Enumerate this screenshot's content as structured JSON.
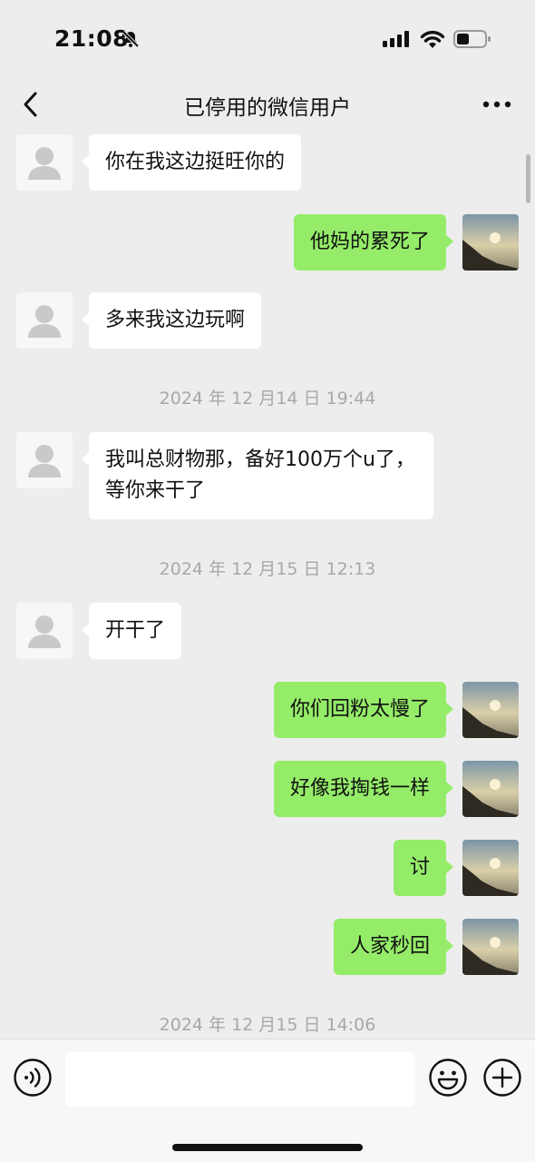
{
  "status_bar": {
    "time": "21:08",
    "icons": [
      "bell-off-icon",
      "signal-icon",
      "wifi-icon",
      "battery-icon"
    ]
  },
  "nav": {
    "title": "已停用的微信用户",
    "back_icon": "chevron-left-icon",
    "more_icon": "more-dots-icon"
  },
  "messages": [
    {
      "side": "left",
      "text": "你在我这边挺旺你的"
    },
    {
      "side": "right",
      "text": "他妈的累死了"
    },
    {
      "side": "left",
      "text": "多来我这边玩啊"
    },
    {
      "timestamp": "2024 年 12 月14 日 19:44"
    },
    {
      "side": "left",
      "text": "我叫总财物那，备好100万个u了，等你来干了"
    },
    {
      "timestamp": "2024 年 12 月15 日 12:13"
    },
    {
      "side": "left",
      "text": "开干了"
    },
    {
      "side": "right",
      "text": "你们回粉太慢了"
    },
    {
      "side": "right",
      "text": "好像我掏钱一样"
    },
    {
      "side": "right",
      "text": "讨"
    },
    {
      "side": "right",
      "text": "人家秒回"
    },
    {
      "timestamp": "2024 年 12 月15 日 14:06"
    }
  ],
  "input_bar": {
    "voice_icon": "voice-icon",
    "input_value": "",
    "emoji_icon": "emoji-icon",
    "plus_icon": "plus-icon"
  },
  "colors": {
    "background": "#ededed",
    "own_bubble": "#95ec69",
    "other_bubble": "#ffffff",
    "timestamp_text": "#a8a8a8"
  }
}
